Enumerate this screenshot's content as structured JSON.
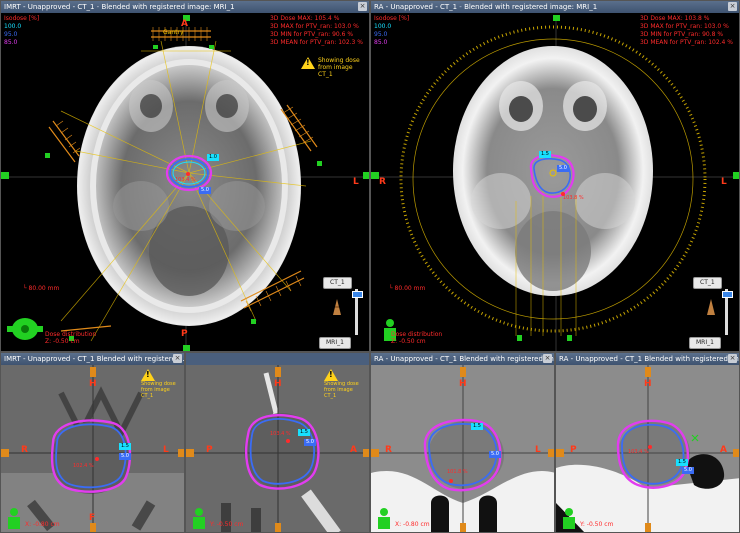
{
  "colors": {
    "title_bar": "#4a5f7d",
    "isodose_pink": "#e23cf0",
    "isodose_blue": "#3a6cf5",
    "isodose_cyan": "#18e0ff",
    "dose_red": "#ff2b2b",
    "field_yellow": "#e8c000",
    "marker_green": "#22d022",
    "warning": "#ffd21a"
  },
  "views": {
    "top_left": {
      "title_plan": "IMRT - Unapproved - CT_1",
      "title_sep": " - ",
      "title_blend": "Blended with registered image: MRI_1",
      "legend": [
        "Isodose [%]",
        "100.0",
        "95.0",
        "85.0"
      ],
      "dose_stats": [
        "3D Dose MAX: 105.4 %",
        "3D MAX for PTV_ran: 103.0 %",
        "3D MIN for PTV_ran: 90.6 %",
        "3D MEAN for PTV_ran: 102.3 %"
      ],
      "warning_text": [
        "Showing dose",
        "from image",
        "CT_1"
      ],
      "orientation": {
        "top": "A",
        "bottom": "P",
        "right": "L"
      },
      "labels": {
        "cyan": "1.0",
        "blue": "5.0",
        "dose": "103.4 %",
        "gantry": "Gantry"
      },
      "scale_text": "80.00 mm",
      "dose_info": [
        "Dose distribution",
        "Z: -0.50 cm"
      ],
      "btn_ct": "CT_1",
      "btn_mri": "MRI_1"
    },
    "top_right": {
      "title_plan": "RA - Unapproved - CT_1",
      "title_sep": " - ",
      "title_blend": "Blended with registered image: MRI_1",
      "legend": [
        "Isodose [%]",
        "100.0",
        "95.0",
        "85.0"
      ],
      "dose_stats": [
        "3D Dose MAX: 103.8 %",
        "3D MAX for PTV_ran: 103.0 %",
        "3D MIN for PTV_ran: 90.8 %",
        "3D MEAN for PTV_ran: 102.4 %"
      ],
      "orientation": {
        "left": "R",
        "right": "L"
      },
      "labels": {
        "cyan": "1.5",
        "blue": "5.0",
        "dose": "103.8 %"
      },
      "scale_text": "80.00 mm",
      "dose_info": [
        "Dose distribution",
        "Z: -0.50 cm"
      ],
      "btn_ct": "CT_1",
      "btn_mri": "MRI_1"
    },
    "bottom_1": {
      "title": "IMRT - Unapproved - CT_1",
      "title_blend": "Blended with registered ...",
      "warning_text": [
        "Showing dose",
        "from image",
        "CT_1"
      ],
      "orientation": {
        "top": "H",
        "left": "R",
        "right": "L",
        "bottom": "F"
      },
      "labels": {
        "cyan": "1.5",
        "blue": "5.0",
        "dose": "102.4 %"
      },
      "scale_text": "X: -0.80 cm"
    },
    "bottom_2": {
      "warning_text": [
        "Showing dose",
        "from image",
        "CT_1"
      ],
      "orientation": {
        "top": "H",
        "left": "P",
        "right": "A"
      },
      "labels": {
        "cyan": "1.5",
        "blue": "5.0",
        "dose": "103.4 %"
      },
      "scale_text": "Y: -0.50 cm"
    },
    "bottom_3": {
      "title": "RA - Unapproved - CT_1",
      "title_blend": "Blended with registered im...",
      "orientation": {
        "top": "H",
        "left": "R",
        "right": "L"
      },
      "labels": {
        "cyan": "1.5",
        "blue": "5.0",
        "dose": "101.8 %"
      },
      "scale_text": "X: -0.80 cm"
    },
    "bottom_4": {
      "title": "RA - Unapproved - CT_1",
      "title_blend": "Blended with registered im...",
      "orientation": {
        "top": "H",
        "left": "P",
        "right": "A"
      },
      "labels": {
        "cyan": "1.5",
        "blue": "5.0",
        "dose": "103.4 %"
      },
      "scale_text": "Y: -0.50 cm"
    }
  }
}
